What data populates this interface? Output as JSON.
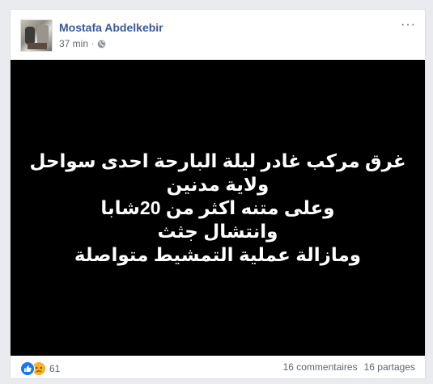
{
  "post": {
    "author": "Mostafa Abdelkebir",
    "time": "37 min",
    "separator": "·",
    "lines": [
      "غرق مركب غادر ليلة البارحة احدى سواحل",
      "ولاية مدنين",
      "وعلى متنه اكثر من 20شابا",
      "وانتشال جثث",
      "ومازالة عملية التمشيط متواصلة"
    ],
    "background_color": "#000000",
    "text_color": "#ffffff"
  },
  "header": {
    "more_label": "···",
    "icons": {
      "privacy": "globe-icon",
      "more": "more-options-icon"
    }
  },
  "footer": {
    "reaction_icons": [
      "like-icon",
      "sad-icon"
    ],
    "reaction_count": "61",
    "comments": "16 commentaires",
    "shares": "16 partages"
  },
  "colors": {
    "author_link": "#385898",
    "meta_text": "#616770",
    "like_blue": "#1877f2",
    "sad_yellow": "#f7b125",
    "page_bg": "#e9ebee"
  }
}
